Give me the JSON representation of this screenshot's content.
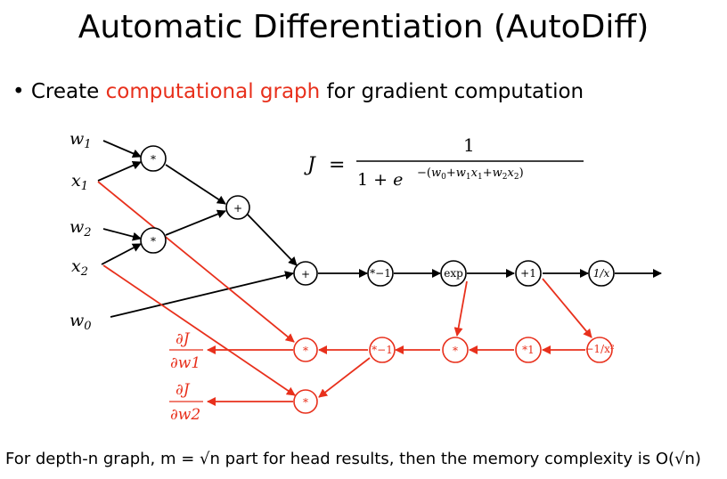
{
  "title": "Automatic Differentiation (AutoDiff)",
  "bullet": {
    "prefix": "• Create ",
    "highlight": "computational graph",
    "suffix": " for gradient computation"
  },
  "inputs": [
    "w1",
    "x1",
    "w2",
    "x2",
    "w0"
  ],
  "formula": {
    "lhs": "J =",
    "numerator": "1",
    "denominator": "1 + e",
    "exponent": "−(w0+w1x1+w2x2)"
  },
  "forward_nodes": [
    "*",
    "*",
    "+",
    "+",
    "*−1",
    "exp",
    "+1",
    "1/x"
  ],
  "backward_nodes": [
    "*",
    "*",
    "*−1",
    "*",
    "*1",
    "−1/x²"
  ],
  "gradients": [
    {
      "num": "∂J",
      "den": "∂w1"
    },
    {
      "num": "∂J",
      "den": "∂w2"
    }
  ],
  "footer": "For depth-n graph, m = √n part for head results, then the memory complexity is O(√n)",
  "colors": {
    "forward": "#000000",
    "backward": "#e8301c"
  }
}
